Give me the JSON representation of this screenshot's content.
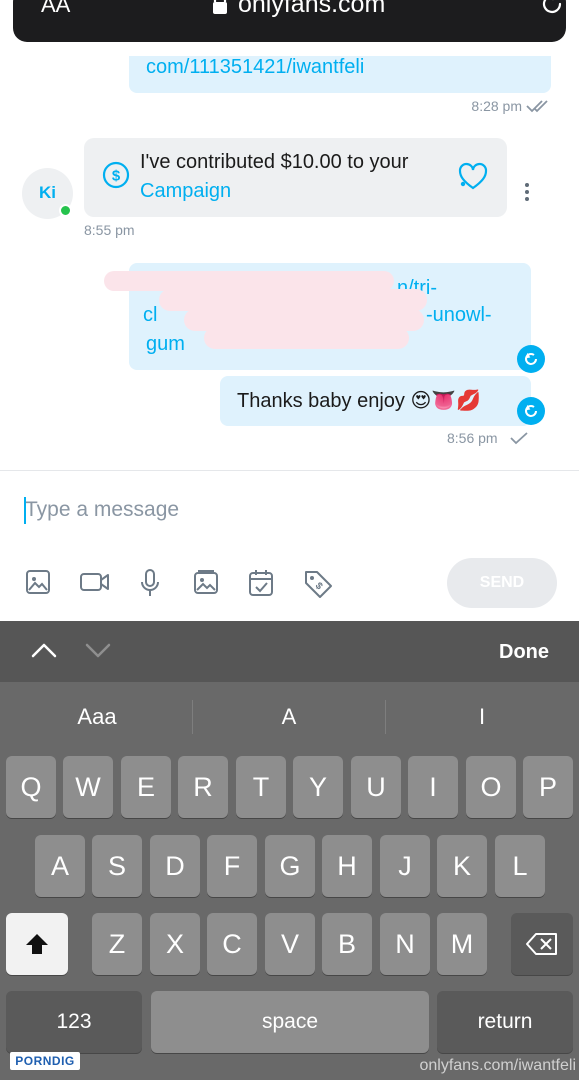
{
  "browser": {
    "text_size_label": "AA",
    "url": "onlyfans.com",
    "lock_icon": "lock-icon",
    "reload_icon": "reload-icon"
  },
  "chat": {
    "messages": [
      {
        "type": "outgoing-link",
        "text": "com/111351421/iwantfeli",
        "time": "8:28 pm",
        "status": "read"
      },
      {
        "type": "incoming-tip",
        "sender_initials": "Ki",
        "online": true,
        "line1": "I've contributed $10.00 to your",
        "line2": "Campaign",
        "time": "8:55 pm"
      },
      {
        "type": "outgoing-link-redacted",
        "fragments": [
          "n/tri-",
          "cl",
          "-unowl-",
          "gum"
        ]
      },
      {
        "type": "outgoing-text",
        "text": "Thanks baby enjoy 😍👅💋",
        "time": "8:56 pm",
        "status": "sent"
      }
    ]
  },
  "composer": {
    "placeholder": "Type a message",
    "send_label": "SEND",
    "tools": [
      "image-icon",
      "video-icon",
      "microphone-icon",
      "gallery-icon",
      "calendar-icon",
      "price-tag-icon"
    ]
  },
  "keyboard": {
    "done_label": "Done",
    "suggestions": [
      "Aaa",
      "A",
      "I"
    ],
    "row1": [
      "Q",
      "W",
      "E",
      "R",
      "T",
      "Y",
      "U",
      "I",
      "O",
      "P"
    ],
    "row2": [
      "A",
      "S",
      "D",
      "F",
      "G",
      "H",
      "J",
      "K",
      "L"
    ],
    "row3": [
      "Z",
      "X",
      "C",
      "V",
      "B",
      "N",
      "M"
    ],
    "numbers_label": "123",
    "space_label": "space",
    "return_label": "return"
  },
  "footer": {
    "caption": "onlyfans.com/iwantfeli",
    "watermark": "PORNDIG"
  },
  "colors": {
    "accent": "#00aff0",
    "outgoing_bubble": "#dff2fd",
    "incoming_bubble": "#eef0f2",
    "online": "#26c34d"
  }
}
